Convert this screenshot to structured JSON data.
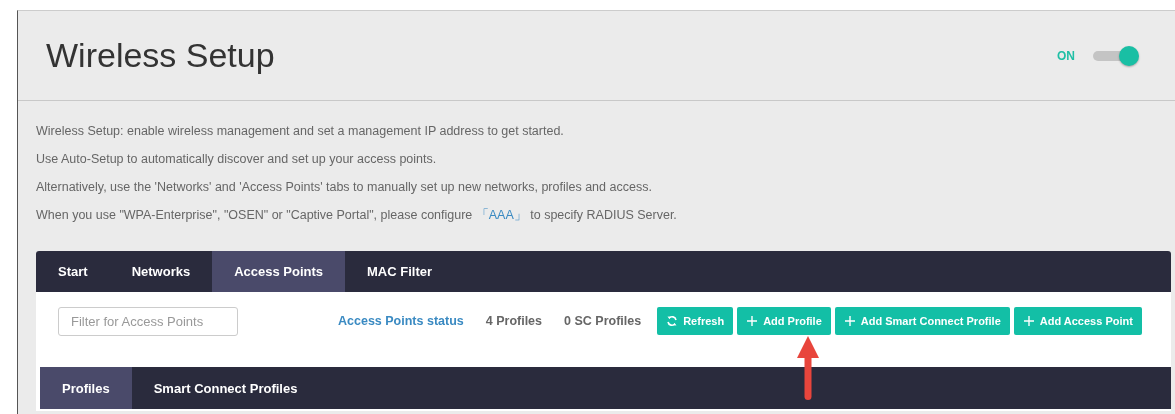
{
  "header": {
    "title": "Wireless Setup",
    "toggle": {
      "label": "ON",
      "on": true
    }
  },
  "description": [
    {
      "text": "Wireless Setup: enable wireless management and set a management IP address to get started."
    },
    {
      "text": "Use Auto-Setup to automatically discover and set up your access points."
    },
    {
      "text": "Alternatively, use the 'Networks' and 'Access Points' tabs to manually set up new networks, profiles and access."
    },
    {
      "text": "When you use \"WPA-Enterprise\", \"OSEN\" or \"Captive Portal\", please configure ",
      "link": "「AAA」",
      "text_after": " to specify RADIUS Server."
    }
  ],
  "tabs": [
    {
      "label": "Start",
      "selected": false
    },
    {
      "label": "Networks",
      "selected": false
    },
    {
      "label": "Access Points",
      "selected": true
    },
    {
      "label": "MAC Filter",
      "selected": false
    }
  ],
  "toolbar": {
    "search": {
      "placeholder": "Filter for Access Points"
    },
    "status_link": "Access Points status",
    "counts": [
      "4 Profiles",
      "0 SC Profiles"
    ],
    "buttons": [
      {
        "label": "Refresh",
        "kind": "refresh"
      },
      {
        "label": "Add Profile",
        "kind": "add"
      },
      {
        "label": "Add Smart Connect Profile",
        "kind": "add"
      },
      {
        "label": "Add Access Point",
        "kind": "add"
      }
    ]
  },
  "subtabs": [
    {
      "label": "Profiles",
      "selected": true
    },
    {
      "label": "Smart Connect Profiles",
      "selected": false
    }
  ]
}
